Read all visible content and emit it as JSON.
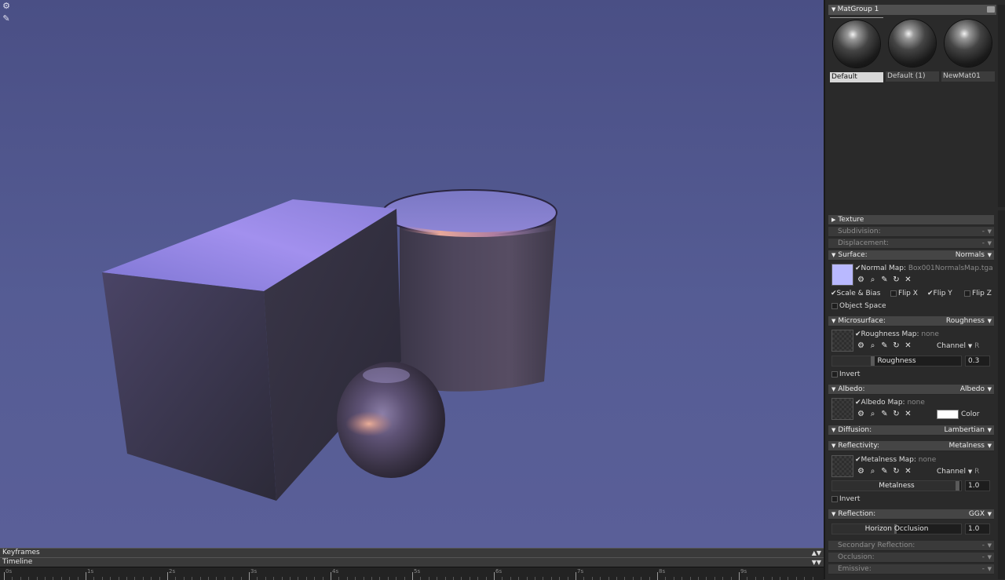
{
  "viewport": {
    "icons": [
      "gear-icon",
      "brush-icon"
    ],
    "colors": {
      "bg_top": "#4a4f85",
      "bg_bottom": "#5a5f98"
    }
  },
  "timeline": {
    "keyframes_label": "Keyframes",
    "timeline_label": "Timeline",
    "ruler_ticks": [
      "0s",
      "1s",
      "2s",
      "3s",
      "4s",
      "5s",
      "6s",
      "7s",
      "8s",
      "9s"
    ]
  },
  "matgroup": {
    "title": "MatGroup 1",
    "materials": [
      {
        "name": "Default",
        "selected": true
      },
      {
        "name": "Default (1)",
        "selected": false
      },
      {
        "name": "NewMat01",
        "selected": false
      }
    ]
  },
  "props": {
    "texture": "Texture",
    "subdivision": {
      "label": "Subdivision:",
      "value": "-"
    },
    "displacement": {
      "label": "Displacement:",
      "value": "-"
    },
    "surface": {
      "label": "Surface:",
      "value": "Normals",
      "map_label": "Normal Map:",
      "map_value": "Box001NormalsMap.tga",
      "swatch_color": "#b9b9ff",
      "scale_bias": "Scale & Bias",
      "flip_x": "Flip X",
      "flip_y": "Flip Y",
      "flip_z": "Flip Z",
      "object_space": "Object Space"
    },
    "microsurface": {
      "label": "Microsurface:",
      "value": "Roughness",
      "map_label": "Roughness Map:",
      "map_value": "none",
      "channel_label": "Channel",
      "channel_value": "R",
      "slider_label": "Roughness",
      "slider_value": "0.3",
      "slider_fraction": 0.3,
      "invert": "Invert"
    },
    "albedo": {
      "label": "Albedo:",
      "value": "Albedo",
      "map_label": "Albedo Map:",
      "map_value": "none",
      "color_label": "Color",
      "color": "#ffffff"
    },
    "diffusion": {
      "label": "Diffusion:",
      "value": "Lambertian"
    },
    "reflectivity": {
      "label": "Reflectivity:",
      "value": "Metalness",
      "map_label": "Metalness Map:",
      "map_value": "none",
      "channel_label": "Channel",
      "channel_value": "R",
      "slider_label": "Metalness",
      "slider_value": "1.0",
      "slider_fraction": 1.0,
      "invert": "Invert"
    },
    "reflection": {
      "label": "Reflection:",
      "value": "GGX",
      "slider_label": "Horizon Occlusion",
      "slider_value": "1.0",
      "slider_fraction": 0.5
    },
    "secondary_reflection": {
      "label": "Secondary Reflection:",
      "value": "-"
    },
    "occlusion": {
      "label": "Occlusion:",
      "value": "-"
    },
    "emissive": {
      "label": "Emissive:",
      "value": "-"
    }
  }
}
